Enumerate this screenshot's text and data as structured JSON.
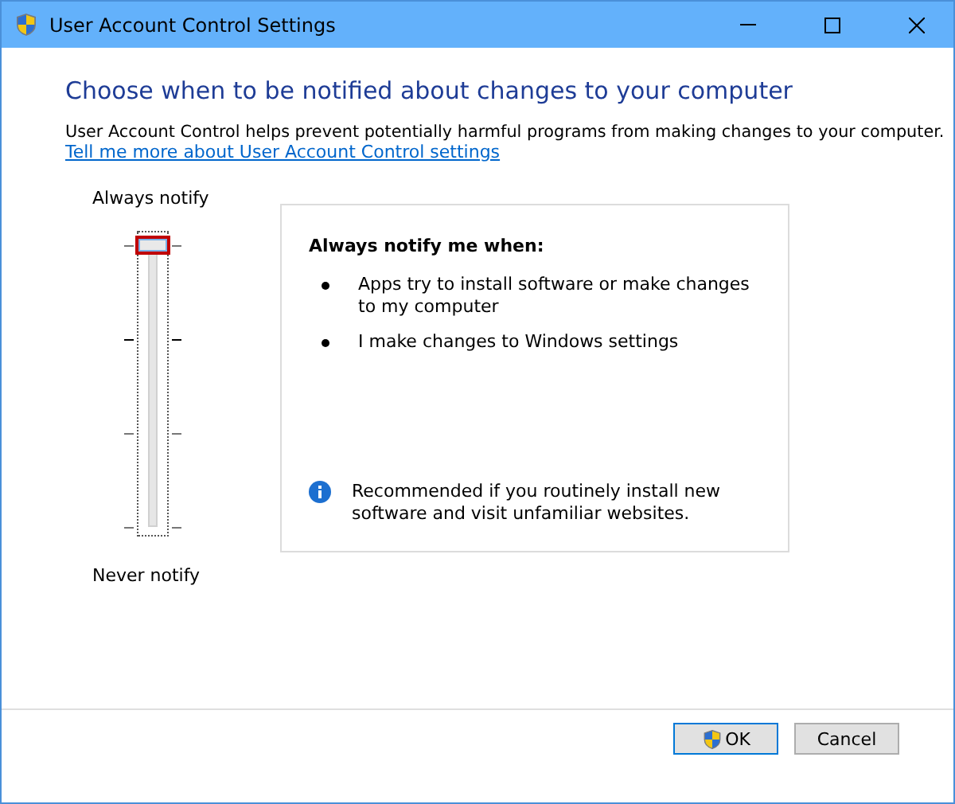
{
  "window": {
    "title": "User Account Control Settings"
  },
  "heading": "Choose when to be notified about changes to your computer",
  "description": "User Account Control helps prevent potentially harmful programs from making changes to your computer.",
  "link": "Tell me more about User Account Control settings",
  "slider": {
    "top_label": "Always notify",
    "bottom_label": "Never notify",
    "level": 1,
    "focused": true
  },
  "panel": {
    "title": "Always notify me when:",
    "bullets": [
      "Apps try to install software or make changes to my computer",
      "I make changes to Windows settings"
    ],
    "note": "Recommended if you routinely install new software and visit unfamiliar websites."
  },
  "buttons": [
    {
      "label": "OK",
      "shield": true
    },
    {
      "label": "Cancel",
      "shield": false
    }
  ]
}
